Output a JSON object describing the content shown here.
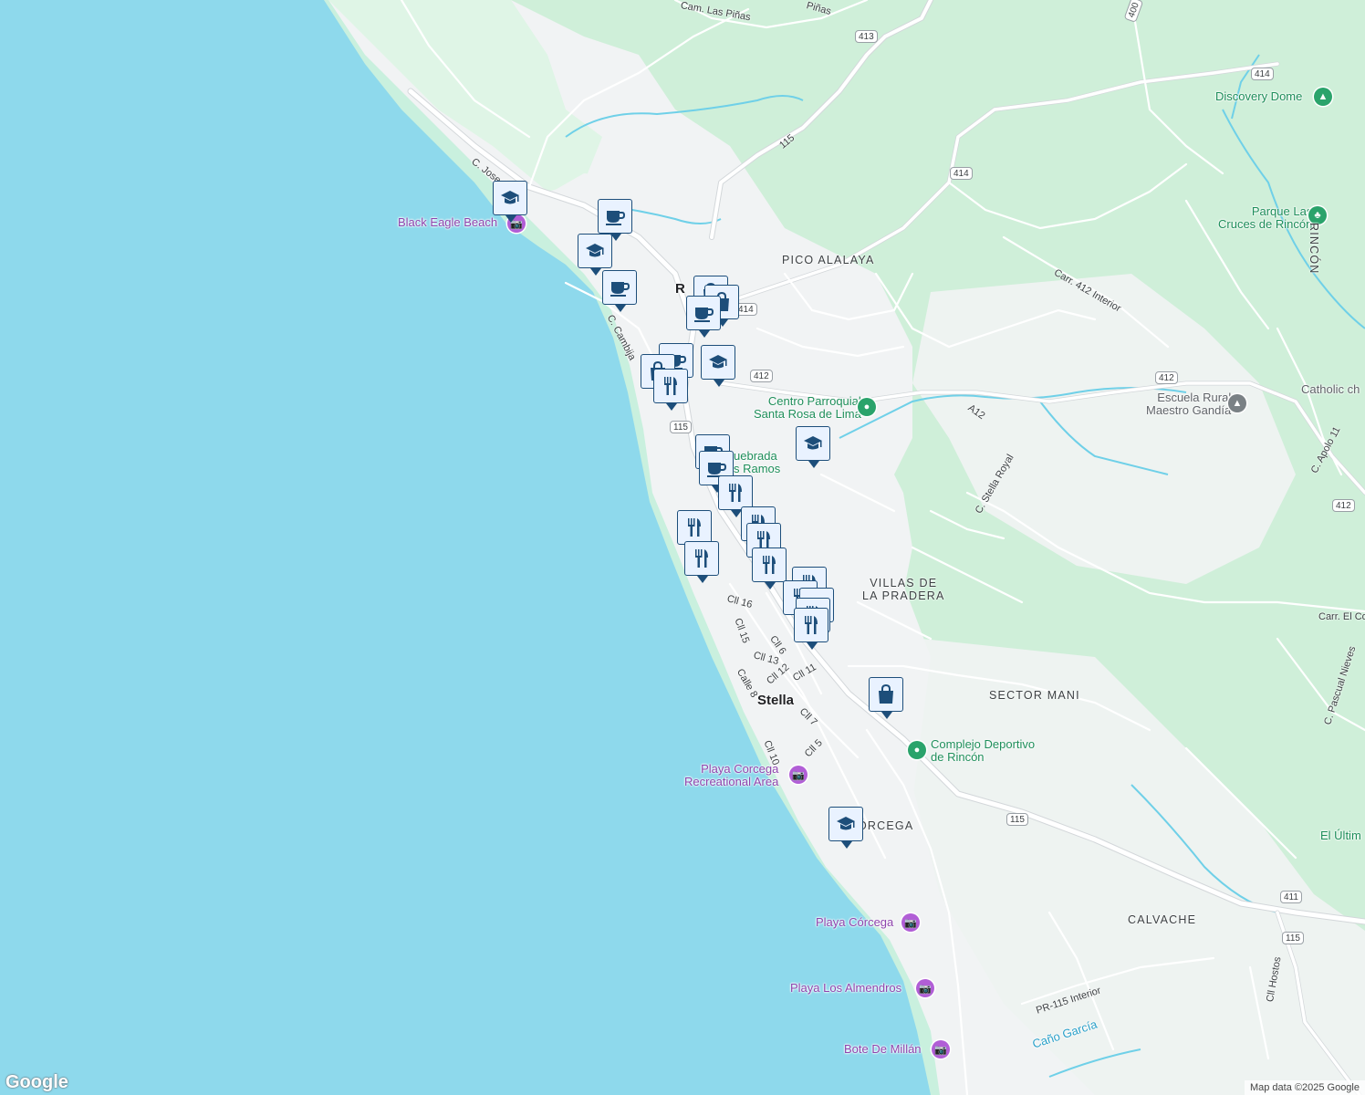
{
  "map": {
    "colors": {
      "water": "#8ed9ec",
      "land": "#f1f3f4",
      "green": "#cfefd9",
      "green_light": "#dff5e6",
      "road": "#ffffff",
      "major_road": "#e6e8ea",
      "stream": "#6fd0e8",
      "pin_fill": "#e9f2ff",
      "pin_stroke": "#1d4e7a"
    },
    "place_labels": [
      {
        "id": "black-eagle-beach",
        "text": "Black Eagle Beach",
        "kind": "purple"
      },
      {
        "id": "pico-alalaya",
        "text": "PICO ALALAYA",
        "kind": "area"
      },
      {
        "id": "rincon-partial",
        "text": "R",
        "kind": "place"
      },
      {
        "id": "discovery-dome",
        "text": "Discovery Dome",
        "kind": "green"
      },
      {
        "id": "parque-las-cruces",
        "text": "Parque Las\nCruces de Rincón",
        "kind": "green"
      },
      {
        "id": "rincon-area",
        "text": "RINCÓN",
        "kind": "area"
      },
      {
        "id": "centro-parroquial",
        "text": "Centro Parroquial\nSanta Rosa de Lima",
        "kind": "green"
      },
      {
        "id": "escuela-rural",
        "text": "Escuela Rural\nMaestro Gandía",
        "kind": "gray"
      },
      {
        "id": "catholic-ch",
        "text": "Catholic ch",
        "kind": "gray"
      },
      {
        "id": "quebrada",
        "text": "uebrada\ns Ramos",
        "kind": "green"
      },
      {
        "id": "villas-de-la-pradera",
        "text": "VILLAS DE\nLA PRADERA",
        "kind": "area"
      },
      {
        "id": "sector-mani",
        "text": "SECTOR MANI",
        "kind": "area"
      },
      {
        "id": "stella",
        "text": "Stella",
        "kind": "place"
      },
      {
        "id": "complejo-deportivo",
        "text": "Complejo Deportivo\nde Rincón",
        "kind": "green"
      },
      {
        "id": "playa-corcega-rec",
        "text": "Playa Corcega\nRecreational Area",
        "kind": "purple"
      },
      {
        "id": "corcega",
        "text": "ÓRCEGA",
        "kind": "area"
      },
      {
        "id": "el-ultim",
        "text": "El Últim",
        "kind": "green"
      },
      {
        "id": "calvache",
        "text": "CALVACHE",
        "kind": "area"
      },
      {
        "id": "playa-corcega",
        "text": "Playa Córcega",
        "kind": "purple"
      },
      {
        "id": "playa-los-almendros",
        "text": "Playa Los Almendros",
        "kind": "purple"
      },
      {
        "id": "bote-de-millan",
        "text": "Bote De Millán",
        "kind": "purple"
      },
      {
        "id": "cano-garcia",
        "text": "Caño García",
        "kind": "stream"
      }
    ],
    "street_labels": [
      {
        "id": "cam-las-pinas",
        "text": "Cam. Las Piñas"
      },
      {
        "id": "pinas-partial",
        "text": "Piñas"
      },
      {
        "id": "c-jose",
        "text": "C. Jose D"
      },
      {
        "id": "c-cambija",
        "text": "C. Cambija"
      },
      {
        "id": "carr-412-interior",
        "text": "Carr. 412 Interior"
      },
      {
        "id": "c-stella-royal",
        "text": "C. Stella Royal"
      },
      {
        "id": "c-apolo-11",
        "text": "C. Apolo 11"
      },
      {
        "id": "carr-el-co",
        "text": "Carr. El Co"
      },
      {
        "id": "c-pascual-nieves",
        "text": "C. Pascual Nieves"
      },
      {
        "id": "cll-16",
        "text": "Cll 16"
      },
      {
        "id": "cll-15",
        "text": "Cll 15"
      },
      {
        "id": "cll-6",
        "text": "Cll 6"
      },
      {
        "id": "cll-13",
        "text": "Cll 13"
      },
      {
        "id": "cll-12",
        "text": "Cll 12"
      },
      {
        "id": "cll-11",
        "text": "Cll 11"
      },
      {
        "id": "calle-8",
        "text": "Calle 8"
      },
      {
        "id": "cll-7",
        "text": "Cll 7"
      },
      {
        "id": "cll-10",
        "text": "Cll 10"
      },
      {
        "id": "cll-5",
        "text": "Cll 5"
      },
      {
        "id": "cll-hostos",
        "text": "Cll Hostos"
      },
      {
        "id": "pr-115-interior",
        "text": "PR-115 Interior"
      },
      {
        "id": "a12",
        "text": "A12"
      },
      {
        "id": "r115-diag",
        "text": "115"
      }
    ],
    "road_shields": [
      {
        "id": "shield-413",
        "text": "413"
      },
      {
        "id": "shield-400",
        "text": "400"
      },
      {
        "id": "shield-414-ne",
        "text": "414"
      },
      {
        "id": "shield-414-mid",
        "text": "414"
      },
      {
        "id": "shield-414-town",
        "text": "414"
      },
      {
        "id": "shield-412-town",
        "text": "412"
      },
      {
        "id": "shield-412-east",
        "text": "412"
      },
      {
        "id": "shield-412-far",
        "text": "412"
      },
      {
        "id": "shield-115-town",
        "text": "115"
      },
      {
        "id": "shield-115-south",
        "text": "115"
      },
      {
        "id": "shield-411",
        "text": "411"
      },
      {
        "id": "shield-115-se",
        "text": "115"
      }
    ],
    "pins": [
      {
        "type": "school"
      },
      {
        "type": "cafe"
      },
      {
        "type": "school"
      },
      {
        "type": "cafe"
      },
      {
        "type": "shop"
      },
      {
        "type": "shop"
      },
      {
        "type": "cafe"
      },
      {
        "type": "cafe"
      },
      {
        "type": "shop"
      },
      {
        "type": "restaurant"
      },
      {
        "type": "school"
      },
      {
        "type": "school"
      },
      {
        "type": "cafe"
      },
      {
        "type": "cafe"
      },
      {
        "type": "restaurant"
      },
      {
        "type": "restaurant"
      },
      {
        "type": "restaurant"
      },
      {
        "type": "restaurant"
      },
      {
        "type": "restaurant"
      },
      {
        "type": "restaurant"
      },
      {
        "type": "restaurant"
      },
      {
        "type": "restaurant"
      },
      {
        "type": "cafe"
      },
      {
        "type": "restaurant"
      },
      {
        "type": "restaurant"
      },
      {
        "type": "shop"
      },
      {
        "type": "school"
      }
    ],
    "attribution": {
      "logo": "Google",
      "text": "Map data ©2025 Google"
    }
  }
}
